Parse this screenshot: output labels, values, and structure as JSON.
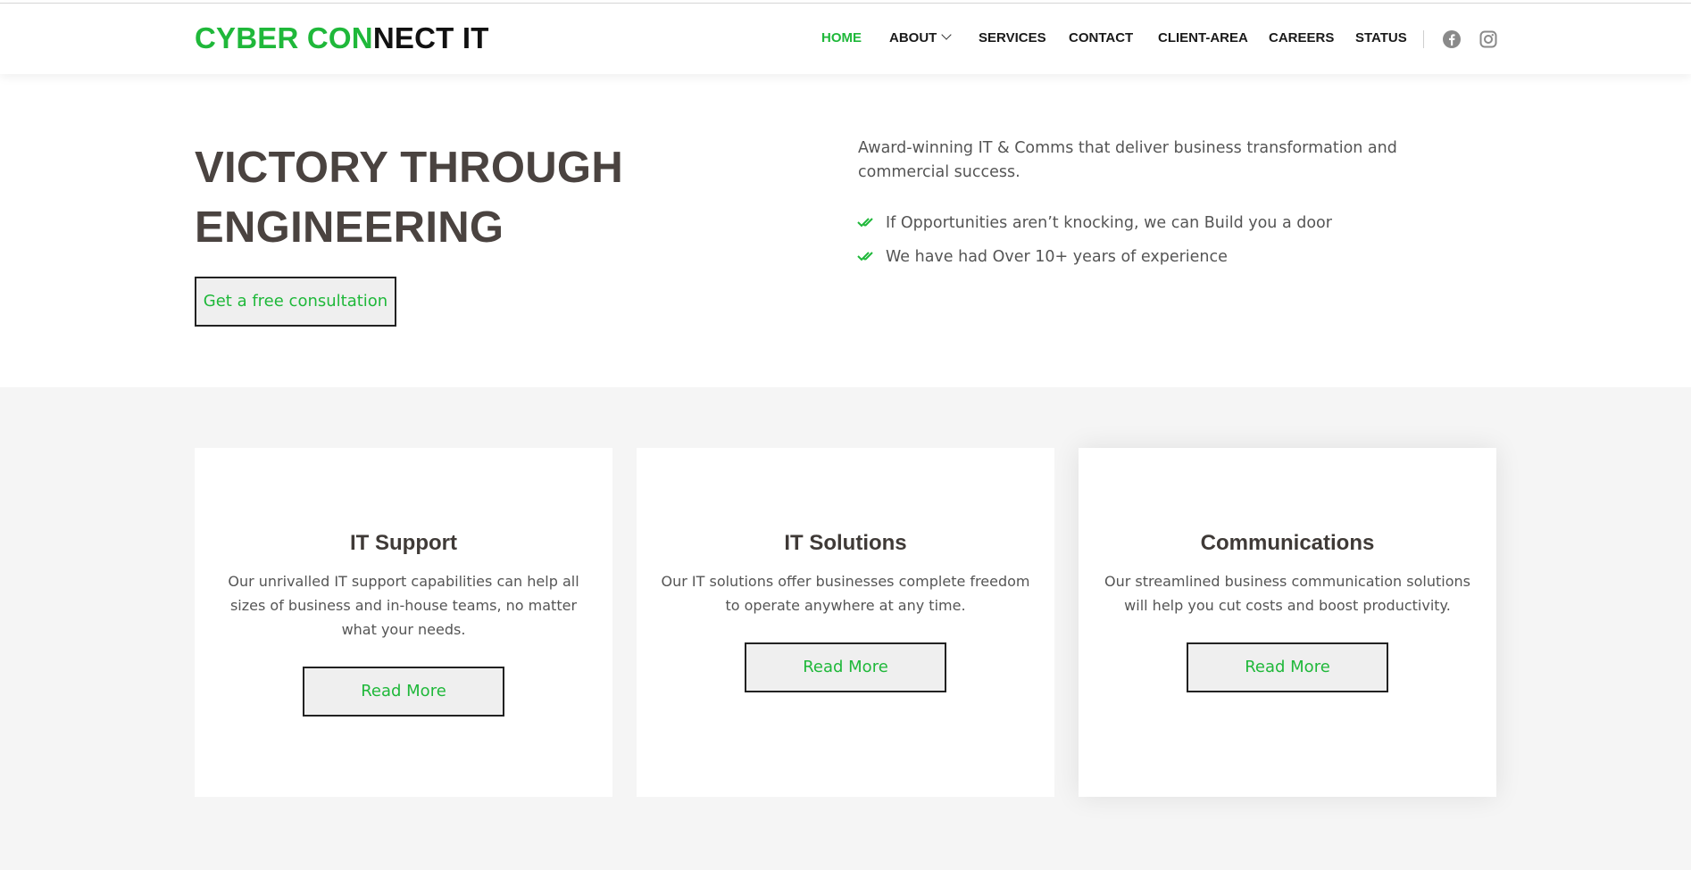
{
  "logo": {
    "part_green": "CYBER CON",
    "part_dark": "NECT IT"
  },
  "nav": {
    "items": [
      {
        "label": "HOME",
        "active": true
      },
      {
        "label": "ABOUT",
        "has_dropdown": true
      },
      {
        "label": "SERVICES"
      },
      {
        "label": "CONTACT"
      },
      {
        "label": "CLIENT-AREA"
      },
      {
        "label": "CAREERS"
      },
      {
        "label": "STATUS"
      }
    ],
    "social": [
      {
        "icon": "facebook-icon"
      },
      {
        "icon": "instagram-icon"
      }
    ]
  },
  "hero": {
    "title_line1": "VICTORY THROUGH",
    "title_line2": "ENGINEERING",
    "cta_label": "Get a free consultation",
    "description": "Award-winning IT & Comms that deliver business transformation and commercial success.",
    "checks": [
      "If Opportunities aren’t knocking, we can Build you a door",
      "We have had Over 10+ years of experience"
    ]
  },
  "services": [
    {
      "title": "IT Support",
      "text": "Our unrivalled IT support capabilities can help all sizes of business and in-house teams, no matter what your needs.",
      "button": "Read More"
    },
    {
      "title": "IT Solutions",
      "text": "Our IT solutions offer businesses complete freedom to operate anywhere at any time.",
      "button": "Read More"
    },
    {
      "title": "Communications",
      "text": "Our streamlined business communication solutions will help you cut costs and boost productivity.",
      "button": "Read More"
    }
  ],
  "colors": {
    "accent": "#1fb83a",
    "heading": "#4a4340",
    "band_bg": "#f5f5f5",
    "icon_gray": "#8a8a8a"
  }
}
